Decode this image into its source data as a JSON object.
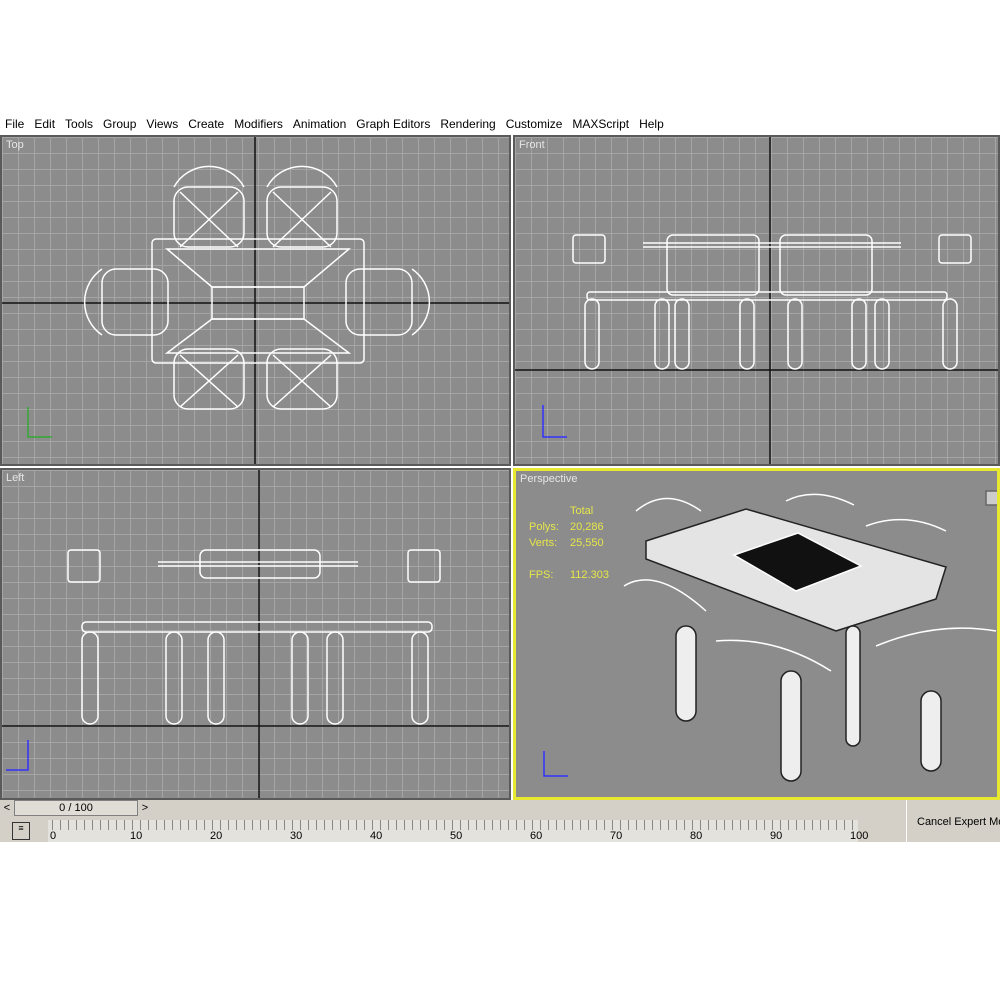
{
  "menu": [
    "File",
    "Edit",
    "Tools",
    "Group",
    "Views",
    "Create",
    "Modifiers",
    "Animation",
    "Graph Editors",
    "Rendering",
    "Customize",
    "MAXScript",
    "Help"
  ],
  "viewports": {
    "top": "Top",
    "front": "Front",
    "left": "Left",
    "perspective": "Perspective"
  },
  "stats": {
    "header": "Total",
    "polys_label": "Polys:",
    "polys": "20,286",
    "verts_label": "Verts:",
    "verts": "25,550",
    "fps_label": "FPS:",
    "fps": "112.303"
  },
  "timeline": {
    "slider": "0 / 100",
    "prev": "<",
    "next": ">",
    "labels": [
      "0",
      "10",
      "20",
      "30",
      "40",
      "50",
      "60",
      "70",
      "80",
      "90",
      "100"
    ]
  },
  "cancel_label": "Cancel Expert Mode",
  "colors": {
    "active_border": "#e8e830",
    "viewport_bg": "#8c8c8c"
  }
}
